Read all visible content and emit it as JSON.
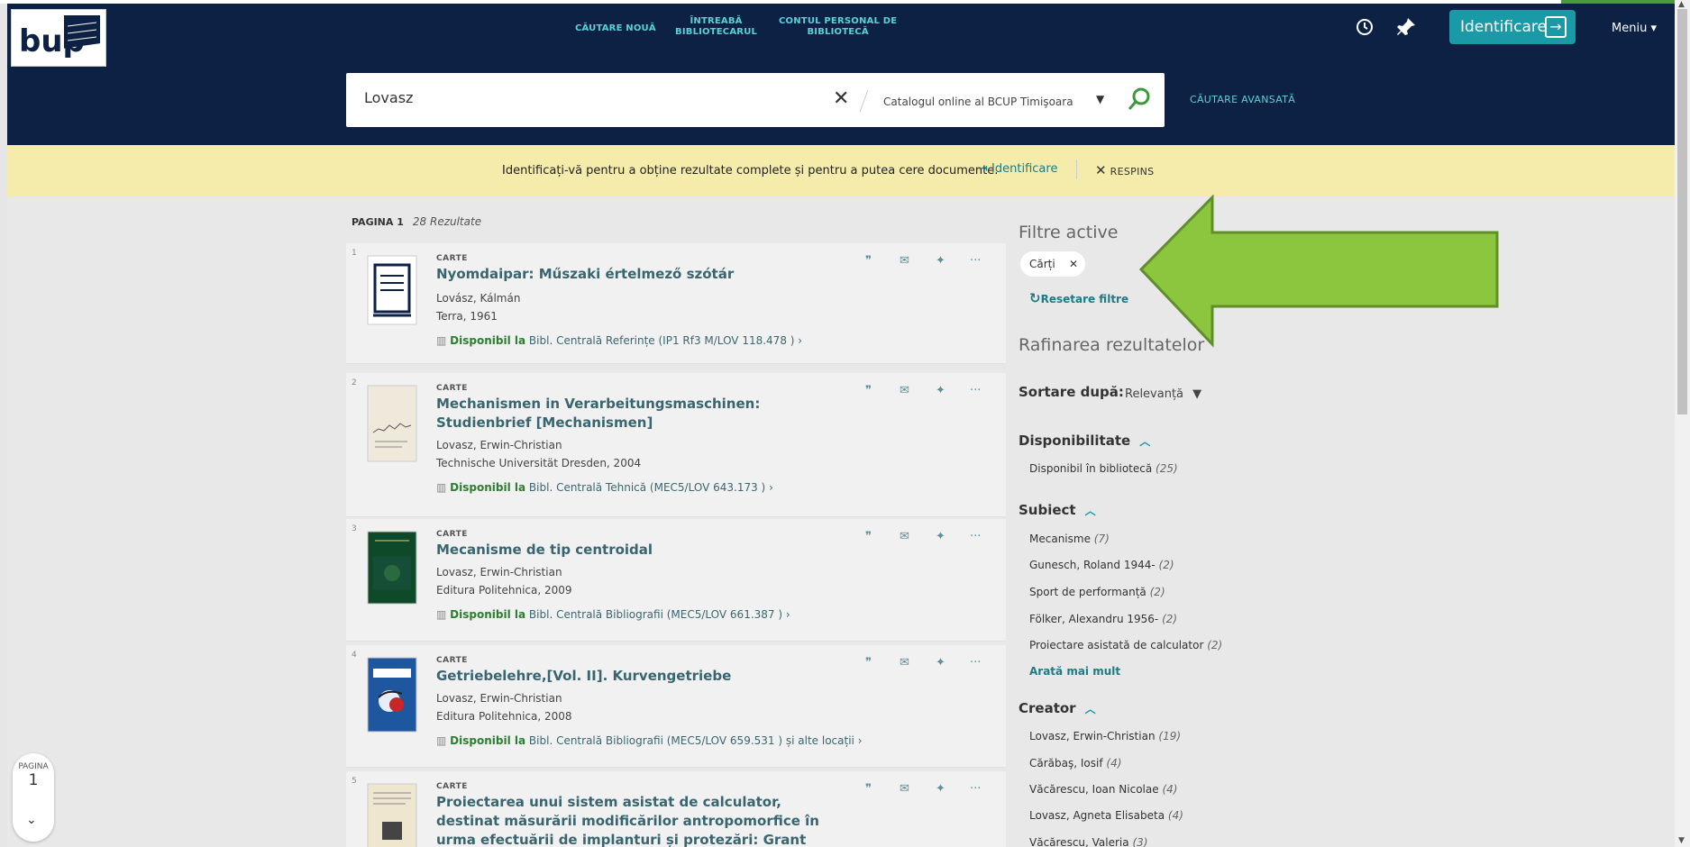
{
  "header": {
    "nav": [
      "CĂUTARE NOUĂ",
      "ÎNTREABĂ\nBIBLIOTECARUL",
      "CONTUL PERSONAL DE\nBIBLIOTECĂ"
    ],
    "login_label": "Identificare",
    "menu_label": "Meniu"
  },
  "search": {
    "query": "Lovasz",
    "scope": "Catalogul online al BCUP Timişoara",
    "advanced_label": "CĂUTARE AVANSATĂ"
  },
  "banner": {
    "message": "Identificați-vă pentru a obține rezultate complete și pentru a putea cere documente.",
    "login_link": "Identificare",
    "dismiss": "RESPINS"
  },
  "results": {
    "page_label": "PAGINA 1",
    "count": "28 Rezultate",
    "items": [
      {
        "num": "1",
        "type": "CARTE",
        "title": "Nyomdaipar: Műszaki értelmező szótár",
        "author": "Lovász, Kálmán",
        "pub": "Terra, 1961",
        "avail": "Disponibil la",
        "loc": "Bibl. Centrală  Referințe (IP1 Rf3 M/LOV 118.478 )",
        "extra": ""
      },
      {
        "num": "2",
        "type": "CARTE",
        "title": "Mechanismen in Verarbeitungsmaschinen: Studienbrief [Mechanismen]",
        "author": "Lovasz, Erwin-Christian",
        "pub": "Technische Universität Dresden, 2004",
        "avail": "Disponibil la",
        "loc": "Bibl. Centrală  Tehnică (MEC5/LOV 643.173 )",
        "extra": ""
      },
      {
        "num": "3",
        "type": "CARTE",
        "title": "Mecanisme de tip centroidal",
        "author": "Lovasz, Erwin-Christian",
        "pub": "Editura Politehnica, 2009",
        "avail": "Disponibil la",
        "loc": "Bibl. Centrală  Bibliografii (MEC5/LOV 661.387 )",
        "extra": ""
      },
      {
        "num": "4",
        "type": "CARTE",
        "title": "Getriebelehre,[Vol. II]. Kurvengetriebe",
        "author": "Lovasz, Erwin-Christian",
        "pub": "Editura Politehnica, 2008",
        "avail": "Disponibil la",
        "loc": "Bibl. Centrală  Bibliografii (MEC5/LOV 659.531 )",
        "extra": "și alte locații"
      },
      {
        "num": "5",
        "type": "CARTE",
        "title": "Proiectarea unui sistem asistat de calculator, destinat măsurării modificărilor antropomorfice în urma efectuării de implanturi și protezări: Grant CNCSIS Tip AT",
        "author": "",
        "pub": "",
        "avail": "",
        "loc": "",
        "extra": ""
      }
    ]
  },
  "facets": {
    "active_title": "Filtre active",
    "active_chip": "Cărți",
    "reset": "Resetare filtre",
    "refine_title": "Rafinarea rezultatelor",
    "sort_label": "Sortare după:",
    "sort_value": "Relevanță",
    "availability": {
      "title": "Disponibilitate",
      "items": [
        {
          "label": "Disponibil în bibliotecă",
          "count": "25"
        }
      ]
    },
    "subject": {
      "title": "Subiect",
      "items": [
        {
          "label": "Mecanisme",
          "count": "7"
        },
        {
          "label": "Gunesch, Roland 1944-",
          "count": "2"
        },
        {
          "label": "Sport de performanță",
          "count": "2"
        },
        {
          "label": "Fölker, Alexandru 1956-",
          "count": "2"
        },
        {
          "label": "Proiectare asistată de calculator",
          "count": "2"
        }
      ],
      "more": "Arată mai mult"
    },
    "creator": {
      "title": "Creator",
      "items": [
        {
          "label": "Lovasz, Erwin-Christian",
          "count": "19"
        },
        {
          "label": "Cărăbaş, Iosif",
          "count": "4"
        },
        {
          "label": "Văcărescu, Ioan Nicolae",
          "count": "4"
        },
        {
          "label": "Lovasz, Agneta Elisabeta",
          "count": "4"
        },
        {
          "label": "Văcărescu, Valeria",
          "count": "3"
        }
      ]
    }
  },
  "page_widget": {
    "label": "PAGINA",
    "number": "1"
  },
  "colors": {
    "header": "#0d2144",
    "accent": "#1a9aa7",
    "banner": "#f5ebab",
    "arrow": "#8cc63f"
  }
}
